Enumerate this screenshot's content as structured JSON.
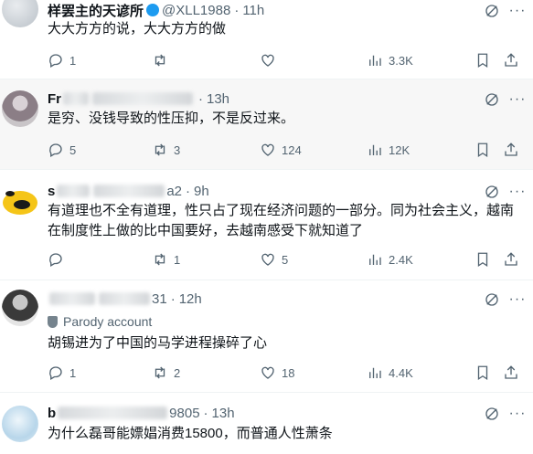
{
  "posts": [
    {
      "name": "样罢主的天谚所",
      "handle": "@XLL1988",
      "time": "11h",
      "text": "大大方方的说，大大方方的做",
      "replies": "1",
      "reposts": "",
      "likes": "",
      "views": "3.3K"
    },
    {
      "name": "Fr",
      "handle": "",
      "time": "13h",
      "text": "是穷、没钱导致的性压抑，不是反过来。",
      "replies": "5",
      "reposts": "3",
      "likes": "124",
      "views": "12K"
    },
    {
      "name": "s",
      "handle": "a2",
      "time": "9h",
      "text": "有道理也不全有道理，性只占了现在经济问题的一部分。同为社会主义，越南在制度性上做的比中国要好，去越南感受下就知道了",
      "replies": "",
      "reposts": "1",
      "likes": "5",
      "views": "2.4K"
    },
    {
      "name": "",
      "handle": "31",
      "time": "12h",
      "badge": "Parody account",
      "text": "胡锡进为了中国的马学进程操碎了心",
      "replies": "1",
      "reposts": "2",
      "likes": "18",
      "views": "4.4K"
    },
    {
      "name": "b",
      "handle": "9805",
      "time": "13h",
      "text": "为什么磊哥能嫖娼消费15800，而普通人性萧条"
    }
  ],
  "separator": "·",
  "colors": {
    "text": "#0f1419",
    "secondary": "#536471",
    "verified": "#1d9bf0",
    "highlight_bg": "#f7f7f7"
  },
  "icons": [
    "reply-icon",
    "repost-icon",
    "like-icon",
    "views-icon",
    "bookmark-icon",
    "share-icon",
    "grok-icon",
    "more-icon"
  ]
}
